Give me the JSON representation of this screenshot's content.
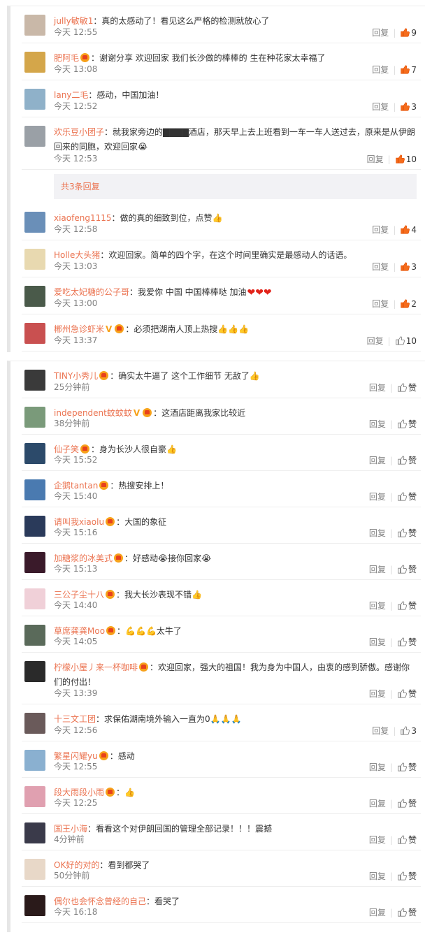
{
  "labels": {
    "reply": "回复",
    "like": "赞"
  },
  "panel1": {
    "comments": [
      {
        "user": "jully敏敏1",
        "badge": false,
        "vbadge": false,
        "text": "：真的太感动了！看见这么严格的检测就放心了",
        "time": "今天 12:55",
        "likes": "9",
        "liked": true,
        "avatar_color": "#c9b8a8"
      },
      {
        "user": "肥阿毛",
        "badge": true,
        "vbadge": false,
        "text": "：谢谢分享 欢迎回家 我们长沙做的棒棒的 生在种花家太幸福了",
        "time": "今天 13:08",
        "likes": "7",
        "liked": true,
        "avatar_color": "#d4a64a"
      },
      {
        "user": "lany二毛",
        "badge": false,
        "vbadge": false,
        "text": "：感动，中国加油！",
        "time": "今天 12:52",
        "likes": "3",
        "liked": true,
        "avatar_color": "#8fb1c9"
      },
      {
        "user": "欢乐豆小团子",
        "badge": false,
        "vbadge": false,
        "text": "：就我家旁边的▇▇▇▇酒店，那天早上去上班看到一车一车人送过去，原来是从伊朗回来的同胞，欢迎回家",
        "emoji": "😭",
        "time": "今天 12:53",
        "likes": "10",
        "liked": true,
        "avatar_color": "#9aa0a6",
        "tall": true
      },
      {
        "reply_count": "共3条回复"
      },
      {
        "user": "xiaofeng1115",
        "badge": false,
        "vbadge": false,
        "text": "：做的真的细致到位，点赞",
        "emoji": "👍",
        "time": "今天 12:58",
        "likes": "4",
        "liked": true,
        "avatar_color": "#6a8fb8"
      },
      {
        "user": "Holle大头猪",
        "badge": false,
        "vbadge": false,
        "text": "：欢迎回家。简单的四个字，在这个时间里确实是最感动人的话语。",
        "time": "今天 13:03",
        "likes": "3",
        "liked": true,
        "avatar_color": "#e8d9b0"
      },
      {
        "user": "爱吃太妃糖的公子哥",
        "badge": false,
        "vbadge": false,
        "text": "：我爱你 中国  中国棒棒哒 加油",
        "hearts": "❤❤❤",
        "time": "今天 13:00",
        "likes": "2",
        "liked": true,
        "avatar_color": "#4a5a4a"
      },
      {
        "user": "郴州急诊虾米",
        "badge": true,
        "vbadge": true,
        "text": "：必须把湖南人顶上热搜",
        "emoji": "👍👍👍",
        "time": "今天 13:37",
        "likes": "10",
        "liked": false,
        "avatar_color": "#c95050"
      }
    ]
  },
  "panel2": {
    "comments": [
      {
        "user": "TINY小秀儿",
        "badge": true,
        "vbadge": false,
        "text": "：确实太牛逼了 这个工作细节 无敌了",
        "emoji": "👍",
        "time": "25分钟前",
        "likes": "赞",
        "avatar_color": "#3a3a3a"
      },
      {
        "user": "independent蚊蚊蚊",
        "badge": true,
        "vbadge": true,
        "text": "：这酒店距离我家比较近",
        "time": "38分钟前",
        "likes": "赞",
        "avatar_color": "#7a9a7a"
      },
      {
        "user": "仙子笑",
        "badge": true,
        "vbadge": false,
        "text": "：身为长沙人很自豪",
        "emoji": "👍",
        "time": "今天 15:52",
        "likes": "赞",
        "avatar_color": "#2c4a6a"
      },
      {
        "user": "企鹅tantan",
        "badge": true,
        "vbadge": false,
        "text": "：热搜安排上！",
        "time": "今天 15:40",
        "likes": "赞",
        "avatar_color": "#4a7ab0"
      },
      {
        "user": "请叫我xiaolu",
        "badge": true,
        "vbadge": false,
        "text": "：大国的象征",
        "time": "今天 15:16",
        "likes": "赞",
        "avatar_color": "#2a3a5a"
      },
      {
        "user": "加糖浆的冰美式",
        "badge": true,
        "vbadge": false,
        "text": "：好感动",
        "emoji": "😭",
        "text2": "接你回家",
        "emoji2": "😭",
        "time": "今天 15:13",
        "likes": "赞",
        "avatar_color": "#3a1a2a"
      },
      {
        "user": "三公子尘十八",
        "badge": true,
        "vbadge": false,
        "text": "：我大长沙表现不错",
        "emoji": "👍",
        "time": "今天 14:40",
        "likes": "赞",
        "avatar_color": "#f0d0d8"
      },
      {
        "user": "草席龚龚Moo",
        "badge": true,
        "vbadge": false,
        "text": "：",
        "emoji": "💪💪💪",
        "text2": "太牛了",
        "time": "今天 14:05",
        "likes": "赞",
        "avatar_color": "#5a6a5a"
      },
      {
        "user": "柠檬小屋丿来一杯咖啡",
        "badge": true,
        "vbadge": false,
        "text": "：欢迎回家，强大的祖国！我为身为中国人，由衷的感到骄傲。感谢你们的付出！",
        "time": "今天 13:39",
        "likes": "赞",
        "avatar_color": "#2a2a2a",
        "tall": true
      },
      {
        "user": "十三文工团",
        "badge": false,
        "vbadge": false,
        "text": "：求保佑湖南境外输入一直为0",
        "emoji": "🙏🙏🙏",
        "time": "今天 12:56",
        "likes": "3",
        "avatar_color": "#6a5a5a"
      },
      {
        "user": "繁星闪耀yu",
        "badge": true,
        "vbadge": false,
        "text": "：感动",
        "time": "今天 12:55",
        "likes": "赞",
        "avatar_color": "#8ab0d0"
      },
      {
        "user": "段大雨段小雨",
        "badge": true,
        "vbadge": false,
        "text": "：",
        "emoji": "👍",
        "time": "今天 12:25",
        "likes": "赞",
        "avatar_color": "#e0a0b0"
      },
      {
        "user": "国王小海",
        "badge": false,
        "vbadge": false,
        "text": "：看看这个对伊朗回国的管理全部记录！！！震撼",
        "time": "4分钟前",
        "likes": "赞",
        "avatar_color": "#3a3a4a"
      },
      {
        "user": "OK好的对的",
        "badge": false,
        "vbadge": false,
        "text": "：看到都哭了",
        "time": "50分钟前",
        "likes": "赞",
        "avatar_color": "#e8d8c8"
      },
      {
        "user": "偶尔也会怀念曾经的自己",
        "badge": false,
        "vbadge": false,
        "text": "：看哭了",
        "time": "今天 16:18",
        "likes": "赞",
        "avatar_color": "#2a1a1a"
      }
    ]
  }
}
